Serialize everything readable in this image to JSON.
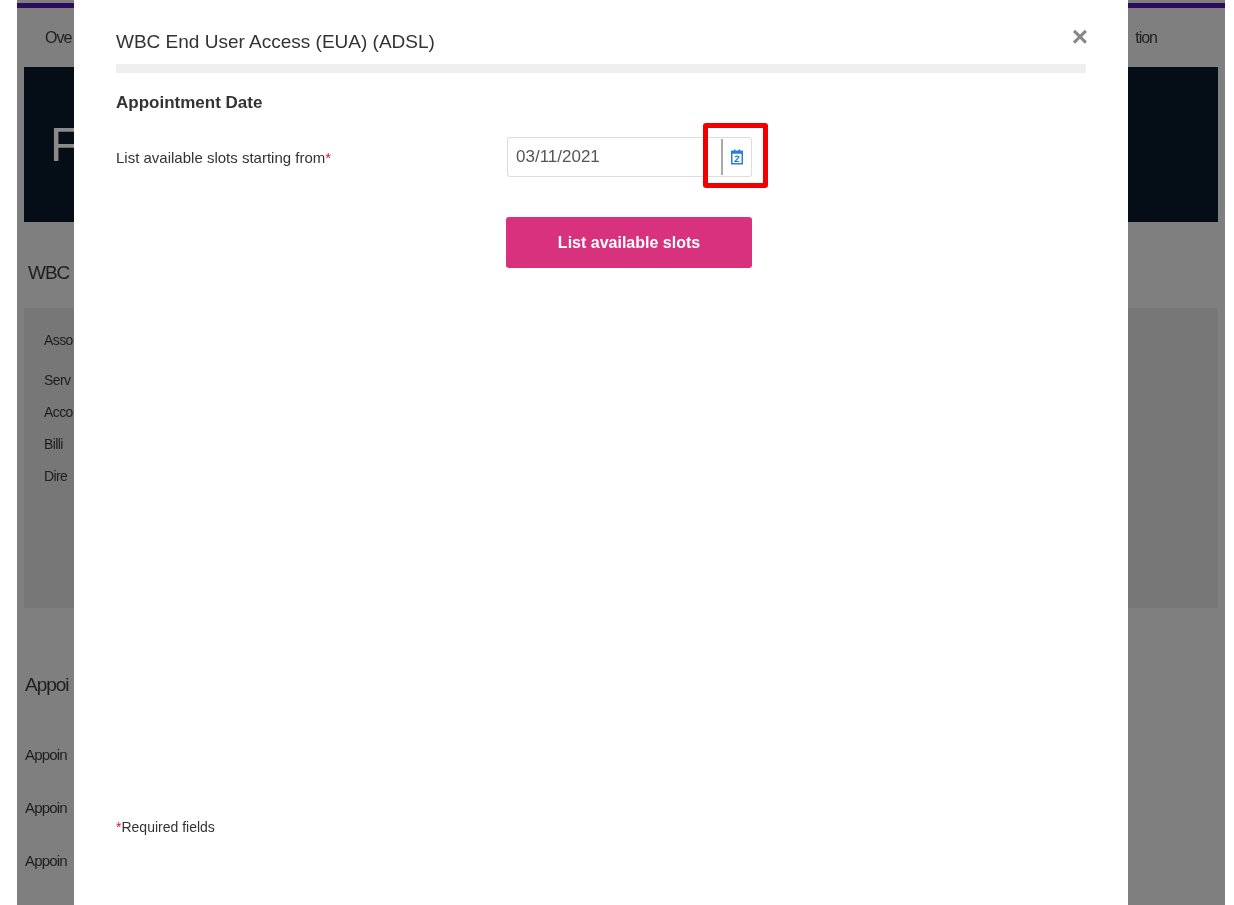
{
  "background_page": {
    "tabs": [
      {
        "label": "Ove"
      },
      {
        "label": "tion"
      }
    ],
    "banner": {
      "title": "F"
    },
    "heading": "WBC",
    "panel": {
      "items": [
        "Asso",
        "Serv",
        "Acco",
        "Billi",
        "Dire"
      ]
    },
    "section_title": "Appoi",
    "rows": [
      "Appoin",
      "Appoin",
      "Appoin"
    ]
  },
  "dialog": {
    "title": "WBC End User Access (EUA) (ADSL)",
    "close": "×",
    "section": "Appointment Date",
    "field": {
      "label": "List available slots starting from",
      "required_mark": "*",
      "value": "03/11/2021",
      "highlighted": true
    },
    "button": "List available slots",
    "footnote": {
      "mark": "*",
      "text": "Required fields"
    }
  }
}
